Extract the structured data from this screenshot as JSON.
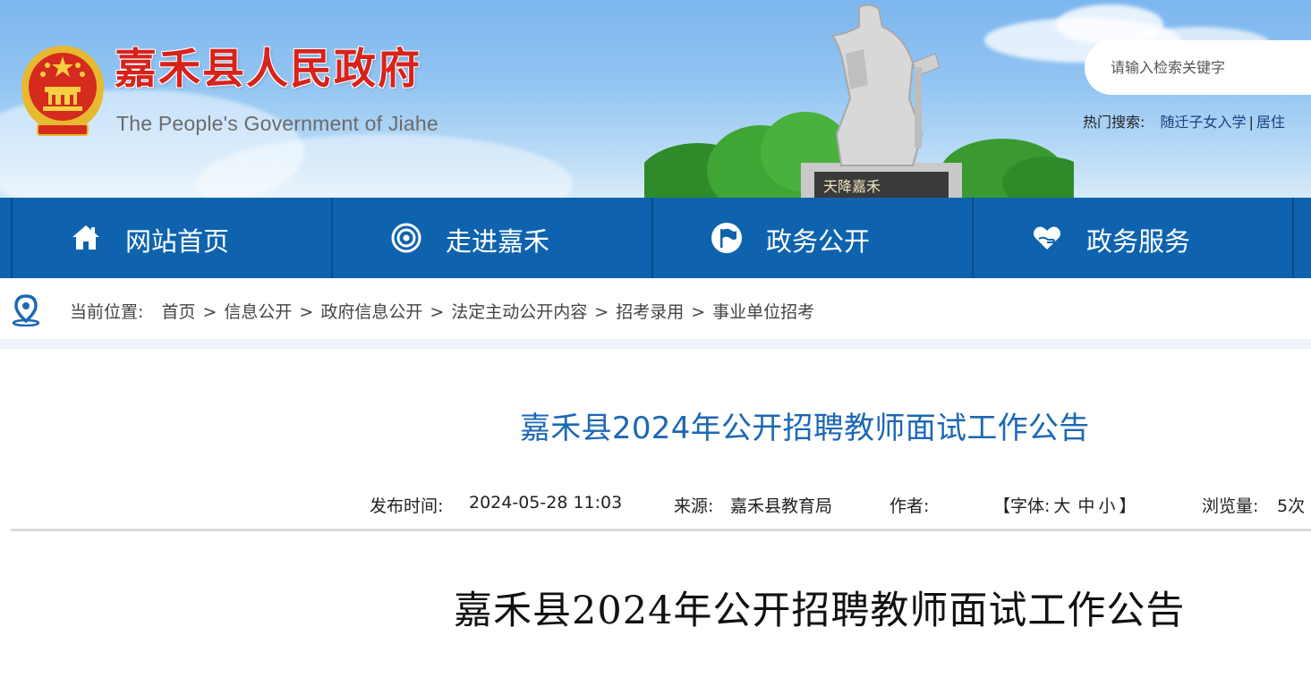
{
  "header": {
    "title": "嘉禾县人民政府",
    "subtitle": "The People's Government of Jiahe",
    "statue_inscription": "天降嘉禾",
    "search": {
      "placeholder": "请输入检索关键字"
    },
    "hot_search": {
      "label": "热门搜索:",
      "items": [
        "随迁子女入学",
        "居住"
      ]
    }
  },
  "nav": {
    "items": [
      {
        "label": "网站首页",
        "icon": "home-icon"
      },
      {
        "label": "走进嘉禾",
        "icon": "target-icon"
      },
      {
        "label": "政务公开",
        "icon": "flag-icon"
      },
      {
        "label": "政务服务",
        "icon": "heart-hand-icon"
      }
    ]
  },
  "breadcrumb": {
    "label": "当前位置:",
    "items": [
      "首页",
      "信息公开",
      "政府信息公开",
      "法定主动公开内容",
      "招考录用",
      "事业单位招考"
    ]
  },
  "article": {
    "title": "嘉禾县2024年公开招聘教师面试工作公告",
    "meta": {
      "publish_label": "发布时间:",
      "publish_time": "2024-05-28 11:03",
      "source_label": "来源:",
      "source": "嘉禾县教育局",
      "author_label": "作者:",
      "author": "",
      "font_open": "【字体:",
      "font_large": "大",
      "font_medium": "中",
      "font_small": "小",
      "font_close": "】",
      "views_label": "浏览量:",
      "views": "5次"
    },
    "content_title": "嘉禾县2024年公开招聘教师面试工作公告"
  },
  "colors": {
    "nav_bg": "#0f63ae",
    "title_red": "#d8221c",
    "article_title_blue": "#1c68b4",
    "link_blue": "#1c3f82"
  }
}
